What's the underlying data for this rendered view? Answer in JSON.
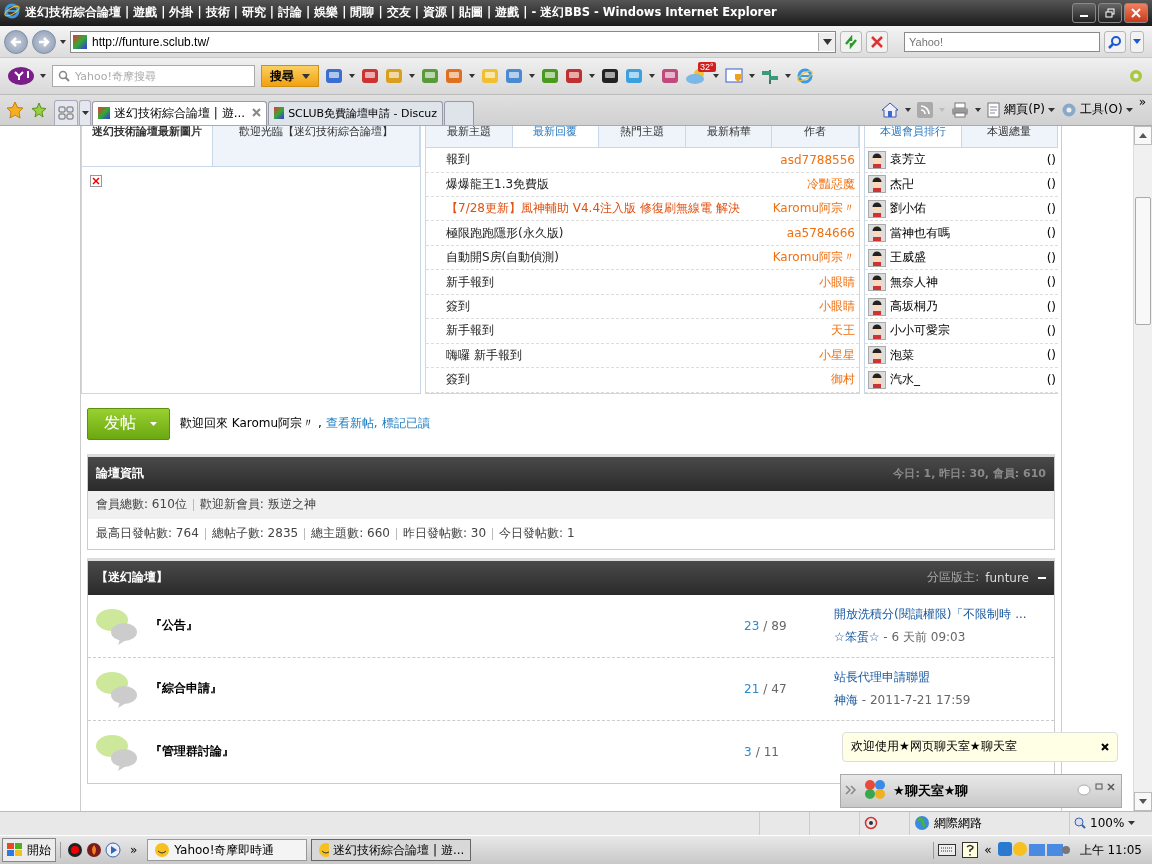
{
  "window": {
    "title": "迷幻技術綜合論壇 | 遊戲 | 外掛 | 技術 | 研究 | 討論 | 娛樂 | 閒聊 | 交友 | 資源 | 貼圖 | 遊戲 | - 迷幻BBS - Windows Internet Explorer"
  },
  "address_bar": {
    "url": "http://funture.sclub.tw/"
  },
  "search_box": {
    "placeholder": "Yahoo!"
  },
  "yahoo_toolbar": {
    "search_placeholder": "Yahoo!奇摩搜尋",
    "search_button": "搜尋",
    "weather_badge": "32°"
  },
  "browser_tabs": [
    {
      "label": "迷幻技術綜合論壇 | 遊...",
      "selected": true
    },
    {
      "label": "SCLUB免費論壇申請 - Discuz",
      "selected": false
    }
  ],
  "command_bar": {
    "page_menu": "網頁(P)",
    "tools_menu": "工具(O)",
    "more": "»"
  },
  "image_panel": {
    "tabs": [
      {
        "label": "迷幻技術論壇最新圖片",
        "selected": true
      },
      {
        "label": "歡迎光臨【迷幻技術綜合論壇】",
        "selected": false
      }
    ]
  },
  "threads_panel": {
    "tabs": [
      {
        "label": "最新主題",
        "selected": false
      },
      {
        "label": "最新回覆",
        "selected": true
      },
      {
        "label": "熱門主題",
        "selected": false
      },
      {
        "label": "最新精華",
        "selected": false
      },
      {
        "label": "作者",
        "selected": false
      }
    ],
    "rows": [
      {
        "title": "報到",
        "author": "asd7788556",
        "highlight": false
      },
      {
        "title": "爆爆龍王1.3免費版",
        "author": "冷豔惡魔",
        "highlight": false
      },
      {
        "title": "【7/28更新】風神輔助 V4.4注入版 修復刷無線電 解決",
        "author": "Karomu阿宗〃",
        "highlight": true
      },
      {
        "title": "極限跑跑隱形(永久版)",
        "author": "aa5784666",
        "highlight": false
      },
      {
        "title": "自動開S房(自動偵測)",
        "author": "Karomu阿宗〃",
        "highlight": false
      },
      {
        "title": "新手報到",
        "author": "小眼睛",
        "highlight": false
      },
      {
        "title": "簽到",
        "author": "小眼睛",
        "highlight": false
      },
      {
        "title": "新手報到",
        "author": "天王",
        "highlight": false
      },
      {
        "title": "嗨囉 新手報到",
        "author": "小星星",
        "highlight": false
      },
      {
        "title": "簽到",
        "author": "御村",
        "highlight": false
      }
    ]
  },
  "members_panel": {
    "tabs": [
      {
        "label": "本週會員排行",
        "selected": true
      },
      {
        "label": "本週總量",
        "selected": false
      }
    ],
    "members": [
      {
        "name": "袁芳立",
        "count": "()"
      },
      {
        "name": "杰卍",
        "count": "()"
      },
      {
        "name": "劉小佑",
        "count": "()"
      },
      {
        "name": "當神也有嗎",
        "count": "()"
      },
      {
        "name": "王威盛",
        "count": "()"
      },
      {
        "name": "無奈人神",
        "count": "()"
      },
      {
        "name": "高坂桐乃",
        "count": "()"
      },
      {
        "name": "小小可愛宗",
        "count": "()"
      },
      {
        "name": "泡菜",
        "count": "()"
      },
      {
        "name": "汽水_",
        "count": "()"
      }
    ]
  },
  "post_button": "发帖",
  "welcome": {
    "text": "歡迎回來 Karomu阿宗〃 ,",
    "links": [
      "查看新帖,",
      "標記已讀"
    ]
  },
  "forum_info": {
    "title": "論壇資訊",
    "header_stats": "今日: 1, 昨日: 30, 會員: 610",
    "line_1": [
      "會員總數: 610位",
      "歡迎新會員: 叛逆之神"
    ],
    "line_2": [
      "最高日發帖數: 764",
      "總帖子數: 2835",
      "總主題數: 660",
      "昨日發帖數: 30",
      "今日發帖數: 1"
    ]
  },
  "forum_group": {
    "title": "【迷幻論壇】",
    "moderator_label": "分區版主:",
    "moderator": "funture",
    "forums": [
      {
        "name": "『公告』",
        "topics": "23",
        "divider": "/",
        "posts": "89",
        "last_title": "開放洗積分(閱讀權限)「不限制時 ...",
        "last_author": "☆笨蛋☆",
        "last_time": "- 6 天前 09:03"
      },
      {
        "name": "『綜合申請』",
        "topics": "21",
        "divider": "/",
        "posts": "47",
        "last_title": "站長代理申請聯盟",
        "last_author": "神海",
        "last_time": "- 2011-7-21 17:59"
      },
      {
        "name": "『管理群討論』",
        "topics": "3",
        "divider": "/",
        "posts": "11"
      }
    ]
  },
  "chat_popup": {
    "message": "欢迎使用★网页聊天室★聊天室"
  },
  "chat_bar": {
    "title": "★聊天室★聊"
  },
  "status_bar": {
    "zone": "網際網路",
    "zoom": "100%"
  },
  "taskbar": {
    "start": "開始",
    "quicklaunch_more": "»",
    "tasks": [
      {
        "label": "Yahoo!奇摩即時通",
        "selected": false
      },
      {
        "label": "迷幻技術綜合論壇 | 遊...",
        "selected": true
      }
    ],
    "tray_expand": "«",
    "clock": "上午 11:05"
  }
}
